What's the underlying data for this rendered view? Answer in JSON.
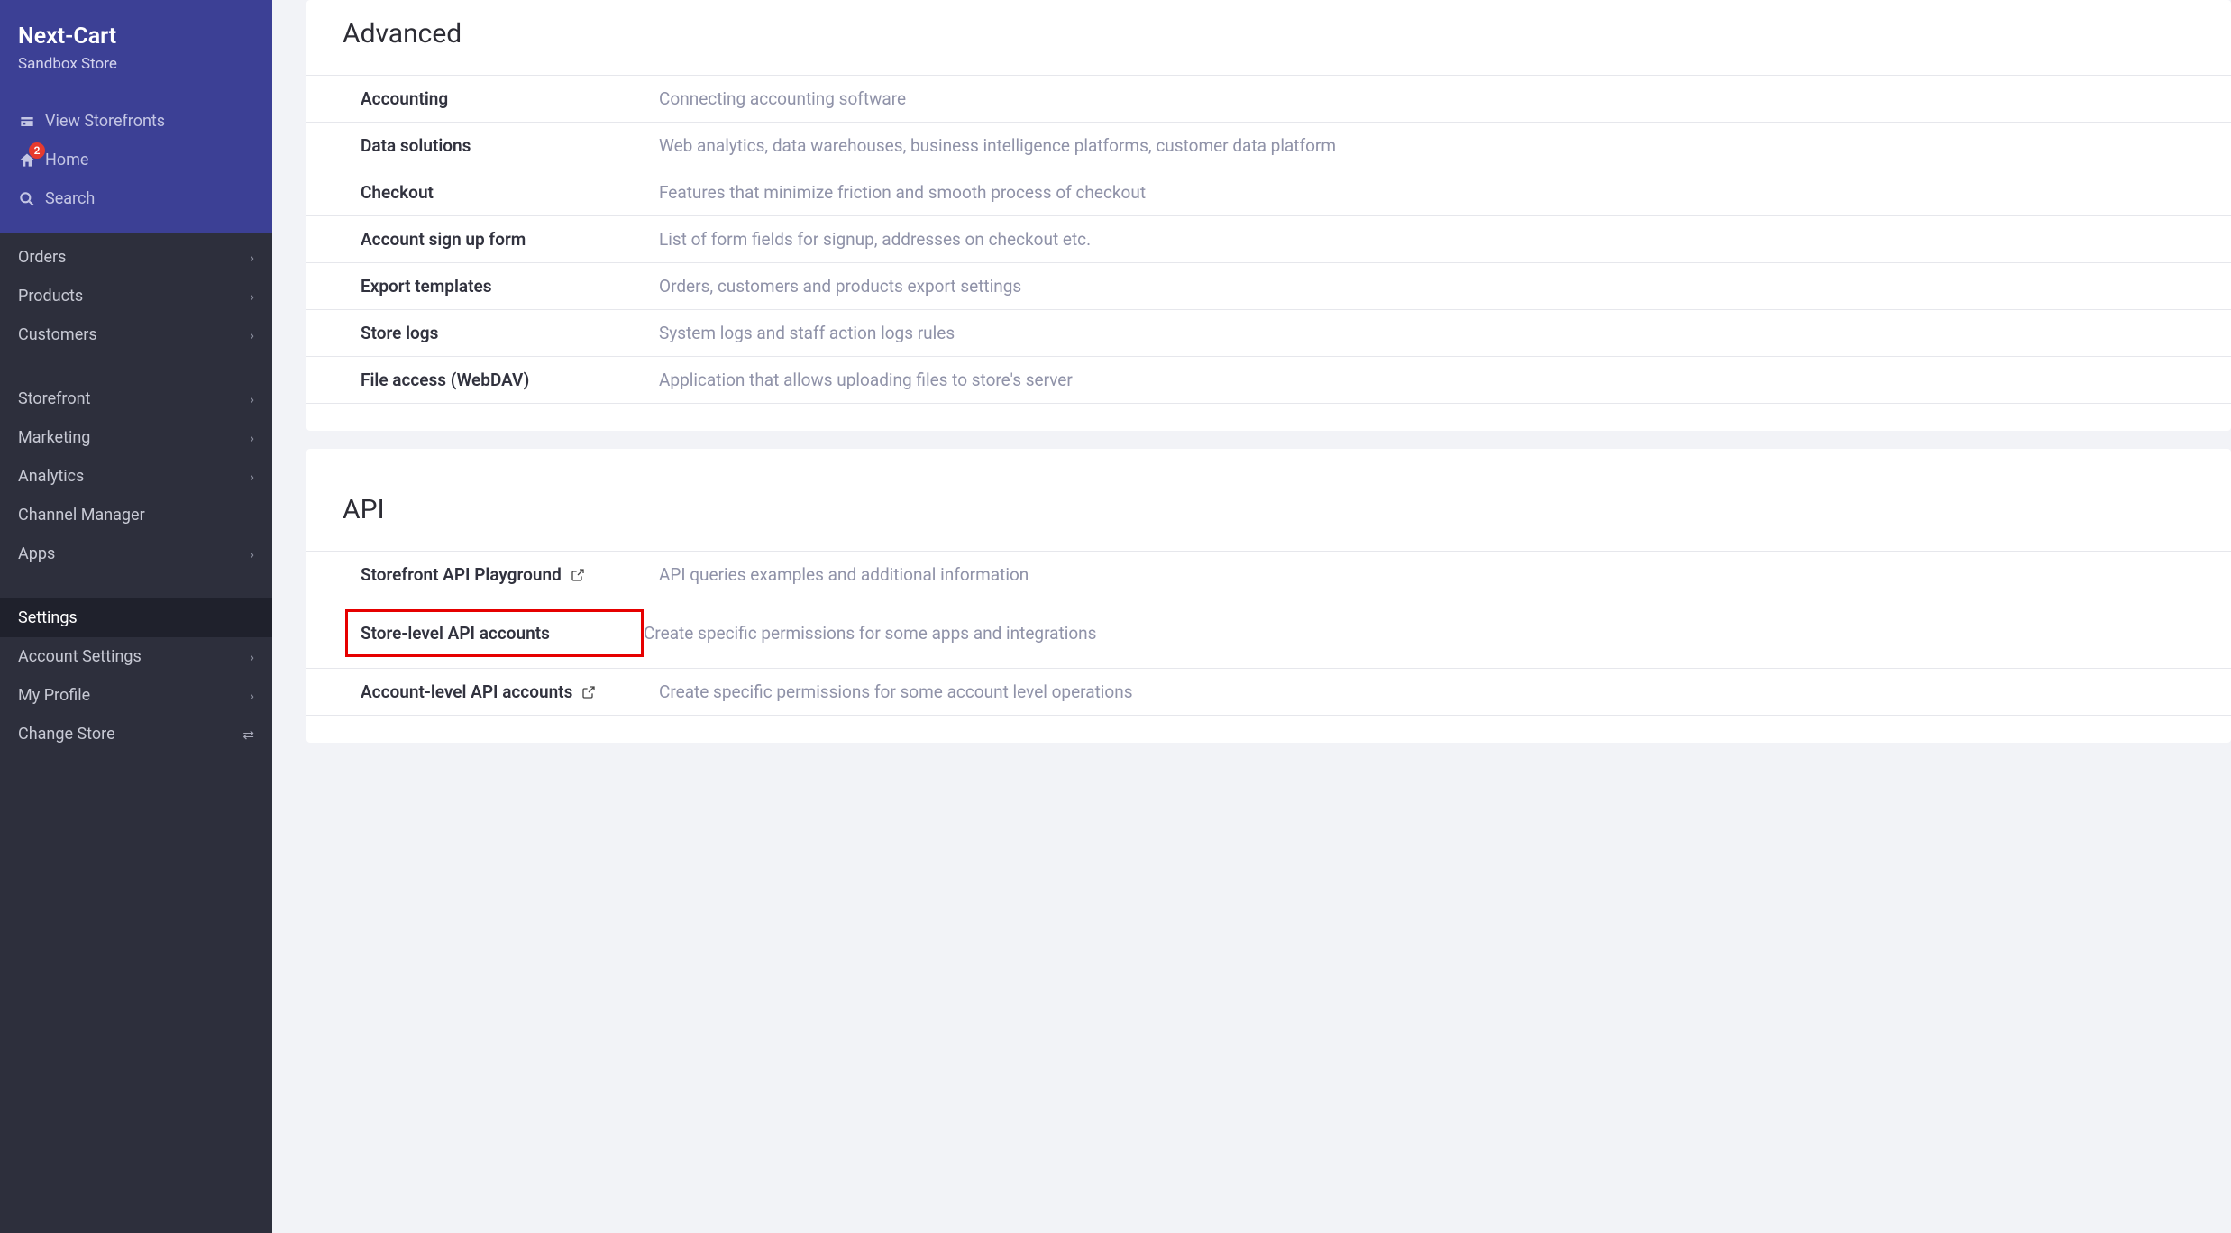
{
  "sidebar": {
    "brand": "Next-Cart",
    "store": "Sandbox Store",
    "primary": [
      {
        "key": "view-storefront",
        "label": "View Storefronts",
        "icon": "store"
      },
      {
        "key": "home",
        "label": "Home",
        "icon": "home",
        "badge": "2"
      },
      {
        "key": "search",
        "label": "Search",
        "icon": "search"
      }
    ],
    "nav1": [
      {
        "key": "orders",
        "label": "Orders",
        "chevron": true
      },
      {
        "key": "products",
        "label": "Products",
        "chevron": true
      },
      {
        "key": "customers",
        "label": "Customers",
        "chevron": true
      }
    ],
    "nav2": [
      {
        "key": "storefront",
        "label": "Storefront",
        "chevron": true
      },
      {
        "key": "marketing",
        "label": "Marketing",
        "chevron": true
      },
      {
        "key": "analytics",
        "label": "Analytics",
        "chevron": true
      },
      {
        "key": "channel-manager",
        "label": "Channel Manager",
        "chevron": false
      },
      {
        "key": "apps",
        "label": "Apps",
        "chevron": true
      }
    ],
    "nav3": [
      {
        "key": "settings",
        "label": "Settings",
        "chevron": false,
        "active": true
      },
      {
        "key": "account-settings",
        "label": "Account Settings",
        "chevron": true
      },
      {
        "key": "my-profile",
        "label": "My Profile",
        "chevron": true
      },
      {
        "key": "change-store",
        "label": "Change Store",
        "swap": true
      }
    ]
  },
  "sections": {
    "advanced": {
      "title": "Advanced",
      "rows": [
        {
          "label": "Accounting",
          "desc": "Connecting accounting software"
        },
        {
          "label": "Data solutions",
          "desc": "Web analytics, data warehouses, business intelligence platforms, customer data platform"
        },
        {
          "label": "Checkout",
          "desc": "Features that minimize friction and smooth process of checkout"
        },
        {
          "label": "Account sign up form",
          "desc": "List of form fields for signup, addresses on checkout etc."
        },
        {
          "label": "Export templates",
          "desc": "Orders, customers and products export settings"
        },
        {
          "label": "Store logs",
          "desc": "System logs and staff action logs rules"
        },
        {
          "label": "File access (WebDAV)",
          "desc": "Application that allows uploading files to store's server"
        }
      ]
    },
    "api": {
      "title": "API",
      "rows": [
        {
          "label": "Storefront API Playground",
          "desc": "API queries examples and additional information",
          "external": true
        },
        {
          "label": "Store-level API accounts",
          "desc": "Create specific permissions for some apps and integrations",
          "highlighted": true
        },
        {
          "label": "Account-level API accounts",
          "desc": "Create specific permissions for some account level operations",
          "external": true
        }
      ]
    }
  }
}
